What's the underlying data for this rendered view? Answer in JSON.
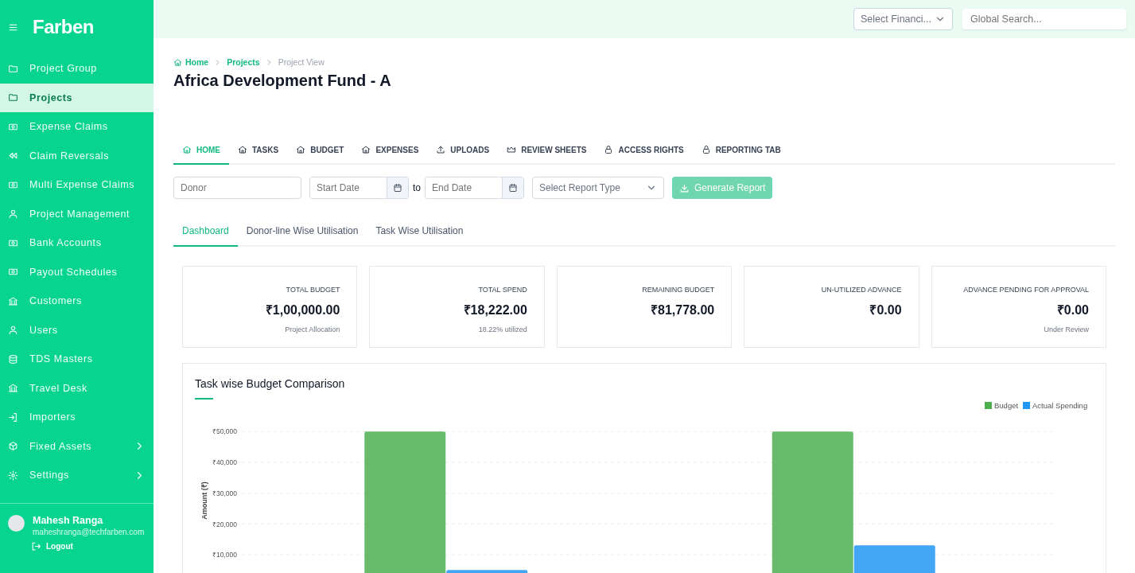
{
  "sidebar": {
    "logo": "Farben",
    "items": [
      {
        "label": "Project Group",
        "selected": false,
        "submenu": false
      },
      {
        "label": "Projects",
        "selected": true,
        "submenu": false
      },
      {
        "label": "Expense Claims",
        "selected": false,
        "submenu": false
      },
      {
        "label": "Claim Reversals",
        "selected": false,
        "submenu": false
      },
      {
        "label": "Multi Expense Claims",
        "selected": false,
        "submenu": false
      },
      {
        "label": "Project Management",
        "selected": false,
        "submenu": false
      },
      {
        "label": "Bank Accounts",
        "selected": false,
        "submenu": false
      },
      {
        "label": "Payout Schedules",
        "selected": false,
        "submenu": false
      },
      {
        "label": "Customers",
        "selected": false,
        "submenu": false
      },
      {
        "label": "Users",
        "selected": false,
        "submenu": false
      },
      {
        "label": "TDS Masters",
        "selected": false,
        "submenu": false
      },
      {
        "label": "Travel Desk",
        "selected": false,
        "submenu": false
      },
      {
        "label": "Importers",
        "selected": false,
        "submenu": false
      },
      {
        "label": "Fixed Assets",
        "selected": false,
        "submenu": true
      },
      {
        "label": "Settings",
        "selected": false,
        "submenu": true
      }
    ],
    "user": {
      "name": "Mahesh Ranga",
      "email": "maheshranga@techfarben.com",
      "logout": "Logout"
    }
  },
  "topbar": {
    "financial_year": {
      "placeholder": "Select Financi..."
    },
    "search": {
      "placeholder": "Global Search..."
    }
  },
  "breadcrumb": [
    "Home",
    "Projects",
    "Project View"
  ],
  "title": "Africa Development Fund - A",
  "tabs": [
    {
      "label": "HOME",
      "selected": true
    },
    {
      "label": "TASKS",
      "selected": false
    },
    {
      "label": "BUDGET",
      "selected": false
    },
    {
      "label": "EXPENSES",
      "selected": false
    },
    {
      "label": "UPLOADS",
      "selected": false
    },
    {
      "label": "REVIEW SHEETS",
      "selected": false
    },
    {
      "label": "ACCESS RIGHTS",
      "selected": false
    },
    {
      "label": "REPORTING TAB",
      "selected": false
    }
  ],
  "filters": {
    "donor": {
      "placeholder": "Donor"
    },
    "start_date": {
      "placeholder": "Start Date"
    },
    "to": "to",
    "end_date": {
      "placeholder": "End Date"
    },
    "report_type": {
      "placeholder": "Select Report Type"
    },
    "generate": {
      "label": "Generate Report",
      "disabled": true
    }
  },
  "subtabs": [
    {
      "label": "Dashboard",
      "selected": true
    },
    {
      "label": "Donor-line Wise Utilisation",
      "selected": false
    },
    {
      "label": "Task Wise Utilisation",
      "selected": false
    }
  ],
  "cards": [
    {
      "label": "TOTAL BUDGET",
      "value": "₹1,00,000.00",
      "note": "Project Allocation"
    },
    {
      "label": "TOTAL SPEND",
      "value": "₹18,222.00",
      "note": "18.22% utilized"
    },
    {
      "label": "REMAINING BUDGET",
      "value": "₹81,778.00"
    },
    {
      "label": "UN-UTILIZED ADVANCE",
      "value": "₹0.00"
    },
    {
      "label": "ADVANCE PENDING FOR APPROVAL",
      "value": "₹0.00",
      "note": "Under Review"
    }
  ],
  "chart": {
    "chart_data": {
      "type": "bar",
      "grid": true,
      "legend": true,
      "title": "Task wise Budget Comparison",
      "ylabel": "Amount (₹)",
      "ylim": [
        0,
        50000
      ],
      "yticks": [
        {
          "value": 10000,
          "label": "₹10,000"
        },
        {
          "value": 20000,
          "label": "₹20,000"
        },
        {
          "value": 30000,
          "label": "₹30,000"
        },
        {
          "value": 40000,
          "label": "₹40,000"
        },
        {
          "value": 50000,
          "label": "₹50,000"
        }
      ],
      "series": [
        {
          "name": "Budget",
          "color": "#4caf50",
          "values": [
            50000,
            50000
          ]
        },
        {
          "name": "Actual Spending",
          "color": "#2196f3",
          "values": [
            5100,
            13100
          ]
        }
      ]
    }
  }
}
